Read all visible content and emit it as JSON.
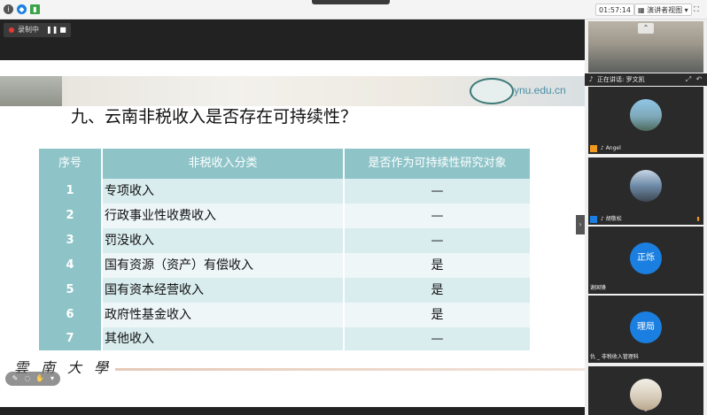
{
  "top_bar": {
    "time": "01:57:14",
    "speaker_view": "演讲者视图"
  },
  "recording": {
    "label": "录制中"
  },
  "slide": {
    "site": "ynu.edu.cn",
    "title": "九、云南非税收入是否存在可持续性？",
    "table": {
      "headers": [
        "序号",
        "非税收入分类",
        "是否作为可持续性研究对象"
      ],
      "rows": [
        {
          "num": "1",
          "name": "专项收入",
          "value": "—"
        },
        {
          "num": "2",
          "name": "行政事业性收费收入",
          "value": "—"
        },
        {
          "num": "3",
          "name": "罚没收入",
          "value": "—"
        },
        {
          "num": "4",
          "name": "国有资源（资产）有偿收入",
          "value": "是"
        },
        {
          "num": "5",
          "name": "国有资本经营收入",
          "value": "是"
        },
        {
          "num": "6",
          "name": "政府性基金收入",
          "value": "是"
        },
        {
          "num": "7",
          "name": "其他收入",
          "value": "—"
        }
      ]
    },
    "footer_logo": "雲南大學"
  },
  "sidebar": {
    "speaking_label": "正在讲话: 罗文凯",
    "participants": [
      {
        "name": "Angel",
        "avatar": "photo"
      },
      {
        "name": "胡敬松",
        "avatar": "photo"
      },
      {
        "name": "谢国锋",
        "avatar_text": "正烁"
      },
      {
        "name": "仇 _ 非税收入管理科",
        "avatar_text": "理局"
      },
      {
        "name": "",
        "avatar": "photo"
      }
    ]
  }
}
